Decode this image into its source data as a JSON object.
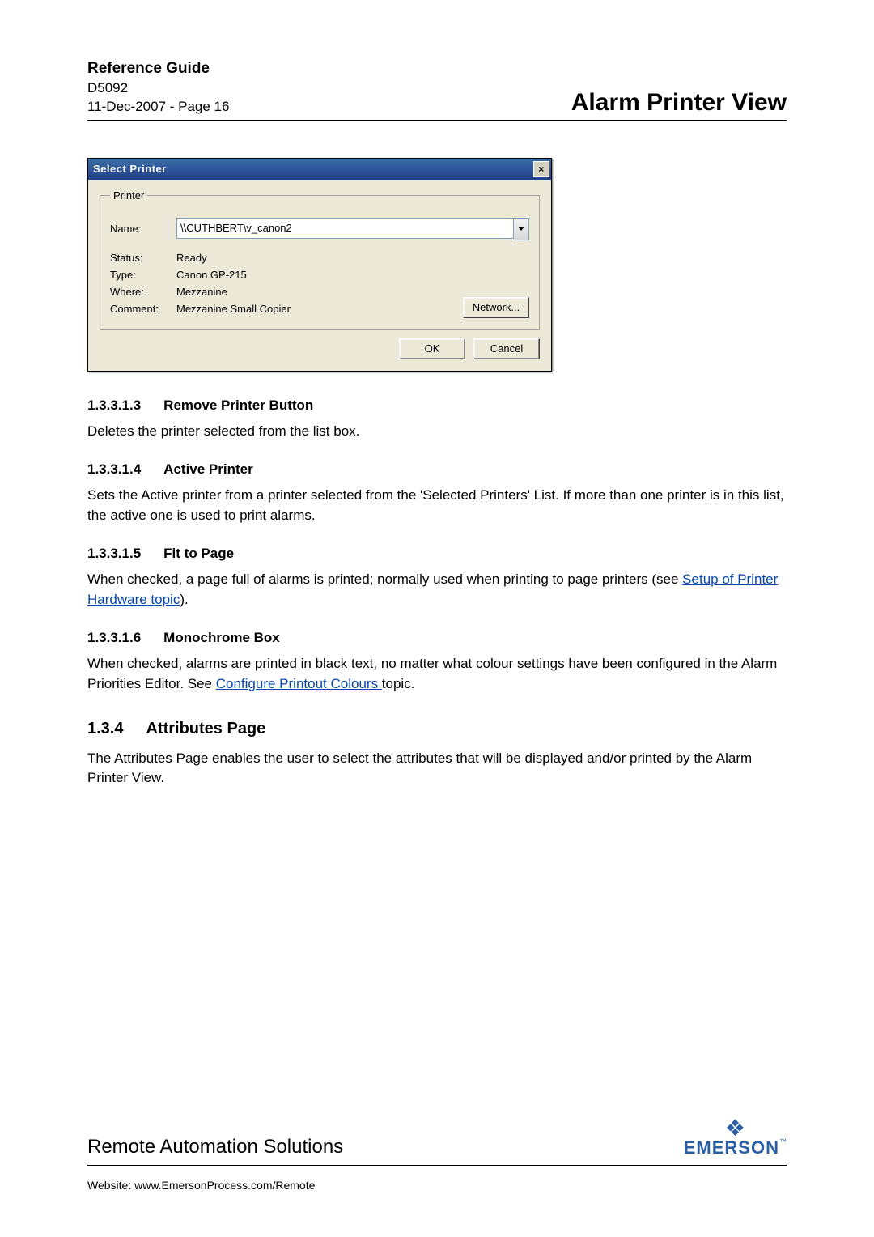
{
  "header": {
    "ref": "Reference Guide",
    "doc": "D5092",
    "meta": "11-Dec-2007 - Page 16",
    "title": "Alarm Printer View"
  },
  "dialog": {
    "title": "Select Printer",
    "close": "×",
    "group_legend": "Printer",
    "name_label": "Name:",
    "name_value": "\\\\CUTHBERT\\v_canon2",
    "status_label": "Status:",
    "status_value": "Ready",
    "type_label": "Type:",
    "type_value": "Canon GP-215",
    "where_label": "Where:",
    "where_value": "Mezzanine",
    "comment_label": "Comment:",
    "comment_value": "Mezzanine Small Copier",
    "network_btn": "Network...",
    "ok_btn": "OK",
    "cancel_btn": "Cancel"
  },
  "sections": {
    "s1_num": "1.3.3.1.3",
    "s1_title": "Remove Printer Button",
    "s1_body": "Deletes the printer selected from the list box.",
    "s2_num": "1.3.3.1.4",
    "s2_title": "Active Printer",
    "s2_body": "Sets the Active printer from a printer selected from the 'Selected Printers' List. If more than one printer is in this list, the active one is used to print alarms.",
    "s3_num": "1.3.3.1.5",
    "s3_title": "Fit to Page",
    "s3_body_a": "When checked, a page full of alarms is printed; normally used when printing to page printers (see ",
    "s3_link": "Setup of Printer Hardware topic",
    "s3_body_b": ").",
    "s4_num": "1.3.3.1.6",
    "s4_title": "Monochrome Box",
    "s4_body_a": "When checked, alarms are printed in black text, no matter what colour settings have been configured in the Alarm Priorities Editor. See ",
    "s4_link": "Configure Printout Colours ",
    "s4_body_b": "topic.",
    "s5_num": "1.3.4",
    "s5_title": "Attributes Page",
    "s5_body": "The Attributes Page enables the user to select the attributes that will be displayed and/or printed by the Alarm Printer View."
  },
  "footer": {
    "ras": "Remote Automation Solutions",
    "website": "Website:   www.EmersonProcess.com/Remote",
    "brand": "EMERSON",
    "mark": "❖"
  }
}
